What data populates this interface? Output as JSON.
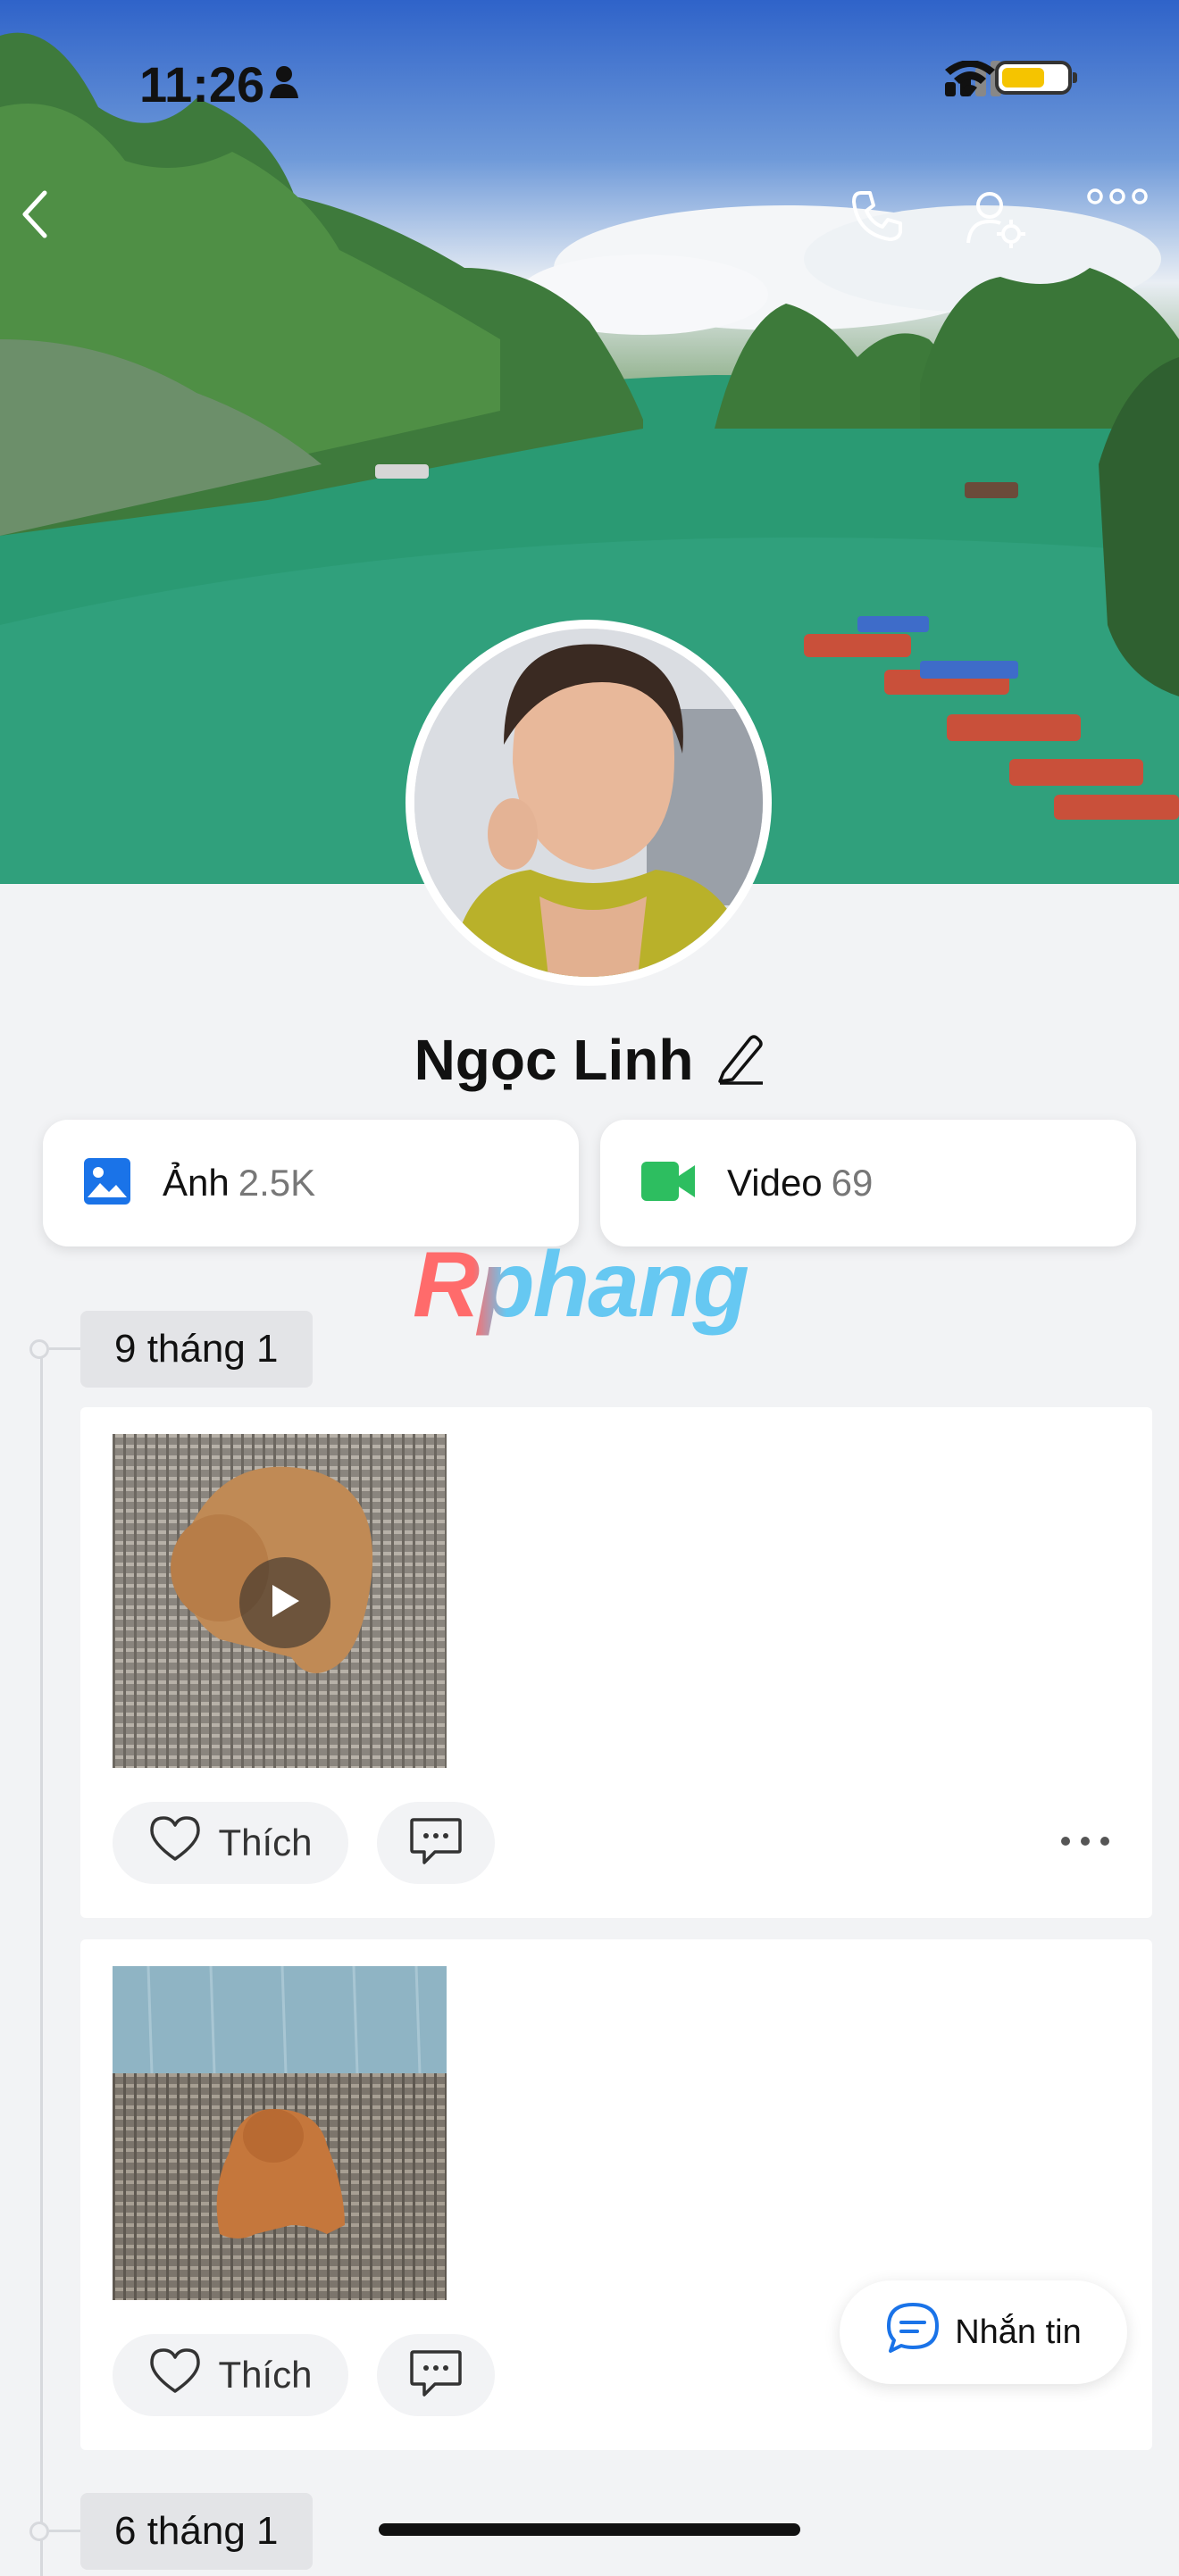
{
  "status_bar": {
    "time": "11:26",
    "battery_level": 0.7
  },
  "profile": {
    "name": "Ngọc Linh"
  },
  "albums": [
    {
      "label": "Ảnh",
      "count": "2.5K",
      "icon": "image-icon",
      "color": "#1a73e8"
    },
    {
      "label": "Video",
      "count": "69",
      "icon": "video-camera-icon",
      "color": "#2dbe60"
    }
  ],
  "watermark": "Rphang",
  "timeline": [
    {
      "date": "9 tháng 1"
    },
    {
      "date": "6 tháng 1"
    }
  ],
  "posts": [
    {
      "like_label": "Thích",
      "has_video": true
    },
    {
      "like_label": "Thích",
      "has_video": false
    }
  ],
  "fab": {
    "label": "Nhắn tin"
  },
  "colors": {
    "accent": "#1a73e8",
    "background": "#f2f3f5"
  }
}
